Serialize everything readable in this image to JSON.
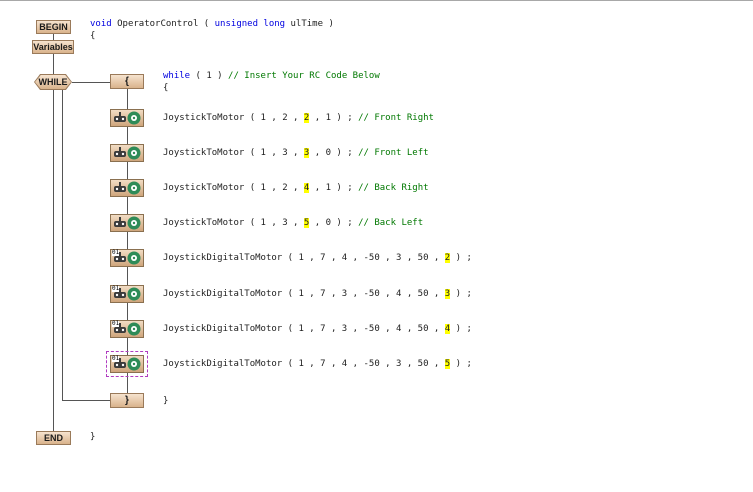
{
  "flow": {
    "begin": "BEGIN",
    "variables": "Variables",
    "while": "WHILE",
    "end": "END",
    "open_brace": "{",
    "close_brace": "}"
  },
  "code": {
    "sig": {
      "void": "void",
      "name": " OperatorControl ( ",
      "type": "unsigned long",
      "param": " ulTime )"
    },
    "open_brace": "{",
    "loop": {
      "kw": "while",
      "cond": " ( 1 ) ",
      "comment": "// Insert Your RC Code Below"
    },
    "loop_open": "{",
    "lines": [
      {
        "pre": "JoystickToMotor ( 1 , 2 , ",
        "hl": "2",
        "post": " , 1 ) ; ",
        "comment": "// Front Right"
      },
      {
        "pre": "JoystickToMotor ( 1 , 3 , ",
        "hl": "3",
        "post": " , 0 ) ; ",
        "comment": "// Front Left"
      },
      {
        "pre": "JoystickToMotor ( 1 , 2 , ",
        "hl": "4",
        "post": " , 1 ) ; ",
        "comment": "// Back Right"
      },
      {
        "pre": "JoystickToMotor ( 1 , 3 , ",
        "hl": "5",
        "post": " , 0 ) ; ",
        "comment": "// Back Left"
      },
      {
        "pre": "JoystickDigitalToMotor ( 1 , 7 , 4 , -50 , 3 , 50 , ",
        "hl": "2",
        "post": " ) ;",
        "comment": ""
      },
      {
        "pre": "JoystickDigitalToMotor ( 1 , 7 , 3 , -50 , 4 , 50 , ",
        "hl": "3",
        "post": " ) ;",
        "comment": ""
      },
      {
        "pre": "JoystickDigitalToMotor ( 1 , 7 , 3 , -50 , 4 , 50 , ",
        "hl": "4",
        "post": " ) ;",
        "comment": ""
      },
      {
        "pre": "JoystickDigitalToMotor ( 1 , 7 , 4 , -50 , 3 , 50 , ",
        "hl": "5",
        "post": " ) ;",
        "comment": ""
      }
    ],
    "loop_close": "}",
    "close_brace": "}"
  },
  "icons": {
    "joystick": "joystick-icon",
    "digital_joystick": "digital-joystick-icon",
    "motor": "motor-icon",
    "digital_label": "01"
  },
  "colors": {
    "keyword": "#0000e0",
    "comment": "#007800",
    "highlight": "#ffff00",
    "block_fill": "#e6c7a5",
    "selection": "#b03cc0"
  }
}
